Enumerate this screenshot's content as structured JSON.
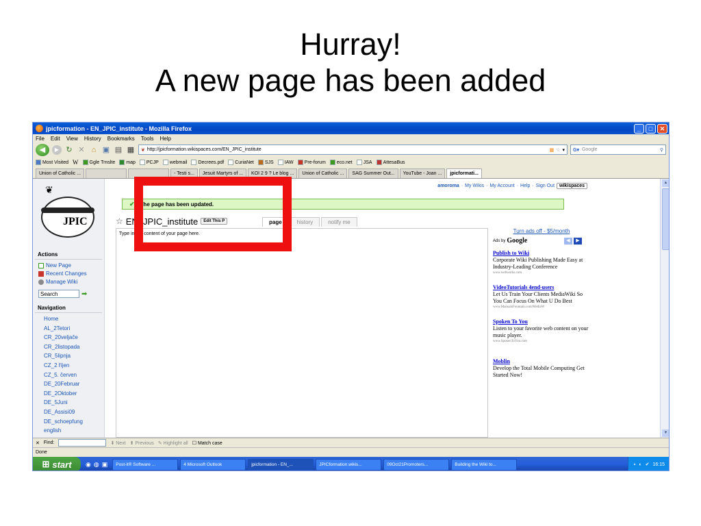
{
  "slide": {
    "title_line1": "Hurray!",
    "title_line2": "A new page has been added"
  },
  "browser": {
    "window_title": "jpicformation - EN_JPIC_institute - Mozilla Firefox",
    "menus": [
      "File",
      "Edit",
      "View",
      "History",
      "Bookmarks",
      "Tools",
      "Help"
    ],
    "url": "http://jpicformation.wikispaces.com/EN_JPIC_institute",
    "search_placeholder": "Google",
    "bookmarks": [
      "Most Visited",
      "W",
      "Ggle Trnslte",
      "map",
      "PCJP",
      "webmail",
      "Decrees.pdf",
      "CuriaNet",
      "SJS",
      "IAW",
      "Pre-forum",
      "eco.net",
      "JSA",
      "AttesaBus"
    ],
    "tabs": [
      "Union of Catholic ...",
      "- Testi s...",
      "Jesuit Martyrs of ...",
      "KOI 2 9 ? Le blog ...",
      "Union of Catholic ...",
      "SAG Summer Out...",
      "YouTube - Joan ...",
      "jpicformati..."
    ],
    "active_tab_index": 7
  },
  "wiki": {
    "user": "amoroma",
    "top_links": [
      "My Wikis",
      "My Account",
      "Help",
      "Sign Out"
    ],
    "brand": "wikispaces",
    "logo_text": "JPIC",
    "flash_message": "The page has been updated.",
    "page_title": "EN_JPIC_institute",
    "edit_button": "Edit This P",
    "page_tabs": [
      "page",
      "history",
      "notify me"
    ],
    "content_placeholder": "Type in the content of your page here.",
    "actions_heading": "Actions",
    "actions": [
      "New Page",
      "Recent Changes",
      "Manage Wiki"
    ],
    "search_value": "Search",
    "navigation_heading": "Navigation",
    "navigation": [
      "Home",
      "AL_2Tetori",
      "CR_20veljače",
      "CR_2listopada",
      "CR_5lipnja",
      "CZ_2 říjen",
      "CZ_5. červen",
      "DE_20Februar",
      "DE_2Oktober",
      "DE_5Juni",
      "DE_Assisi09",
      "DE_schoepfung",
      "english"
    ]
  },
  "ads": {
    "turn_off": "Turn ads off - $5/month",
    "ads_by": "Ads by",
    "google": "Google",
    "items": [
      {
        "title": "Publish to Wiki",
        "body": "Corporate Wiki Publishing Made Easy at Industry-Leading Conference",
        "url": "www.webworks.com"
      },
      {
        "title": "VideoTutorials 4end-users",
        "body": "Let Us Train Your Clients MediaWiki So You Can Focus On What U Do Best",
        "url": "www.ManualsFountain.com/MediaW"
      },
      {
        "title": "Spoken To You",
        "body": "Listen to your favorite web content on your music player.",
        "url": "www.SpokenToYou.com"
      },
      {
        "title": "Moblin",
        "body": "Develop the Total Mobile Computing Get Started Now!",
        "url": ""
      }
    ]
  },
  "findbar": {
    "label": "Find:",
    "next": "Next",
    "previous": "Previous",
    "highlight": "Highlight all",
    "match_case": "Match case"
  },
  "status": "Done",
  "taskbar": {
    "start": "start",
    "items": [
      "Post-it® Software ...",
      "4 Microsoft Outlook",
      "jpicformation - EN_...",
      "JPICformation.wikis...",
      "09Oct21Promoters...",
      "Building the Wiki to..."
    ],
    "active_index": 2,
    "clock": "16:15"
  },
  "colors": {
    "highlight_box": "#ee0f0f",
    "flash_bg": "#dcf7c4",
    "link": "#1a55b5",
    "taskbar": "#245edb"
  }
}
